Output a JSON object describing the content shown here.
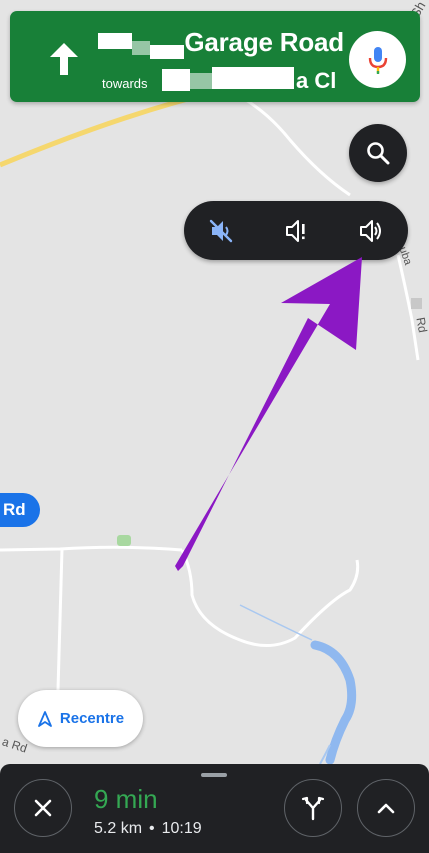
{
  "navigation": {
    "street_name": "Garage Road",
    "towards_label": "towards",
    "towards_name": "a Cl"
  },
  "map": {
    "labels": [
      "Sh",
      "uba",
      "Rd",
      "a Rd"
    ],
    "road_badge": "Rd"
  },
  "recentre": {
    "label": "Recentre"
  },
  "eta": {
    "time": "9 min",
    "distance": "5.2 km",
    "separator": "•",
    "arrival": "10:19"
  },
  "icons": {
    "turn": "arrow-up-icon",
    "mic": "mic-icon",
    "search": "search-icon",
    "mute": "volume-mute-icon",
    "alerts": "volume-alert-icon",
    "sound": "volume-up-icon",
    "recentre": "navigation-arrow-icon",
    "close": "close-icon",
    "routes": "fork-icon",
    "expand": "chevron-up-icon"
  },
  "colors": {
    "banner": "#188038",
    "active_icon": "#8ab4f8",
    "eta_green": "#34a853",
    "accent_blue": "#1a73e8",
    "annotation": "#8b18c4"
  }
}
